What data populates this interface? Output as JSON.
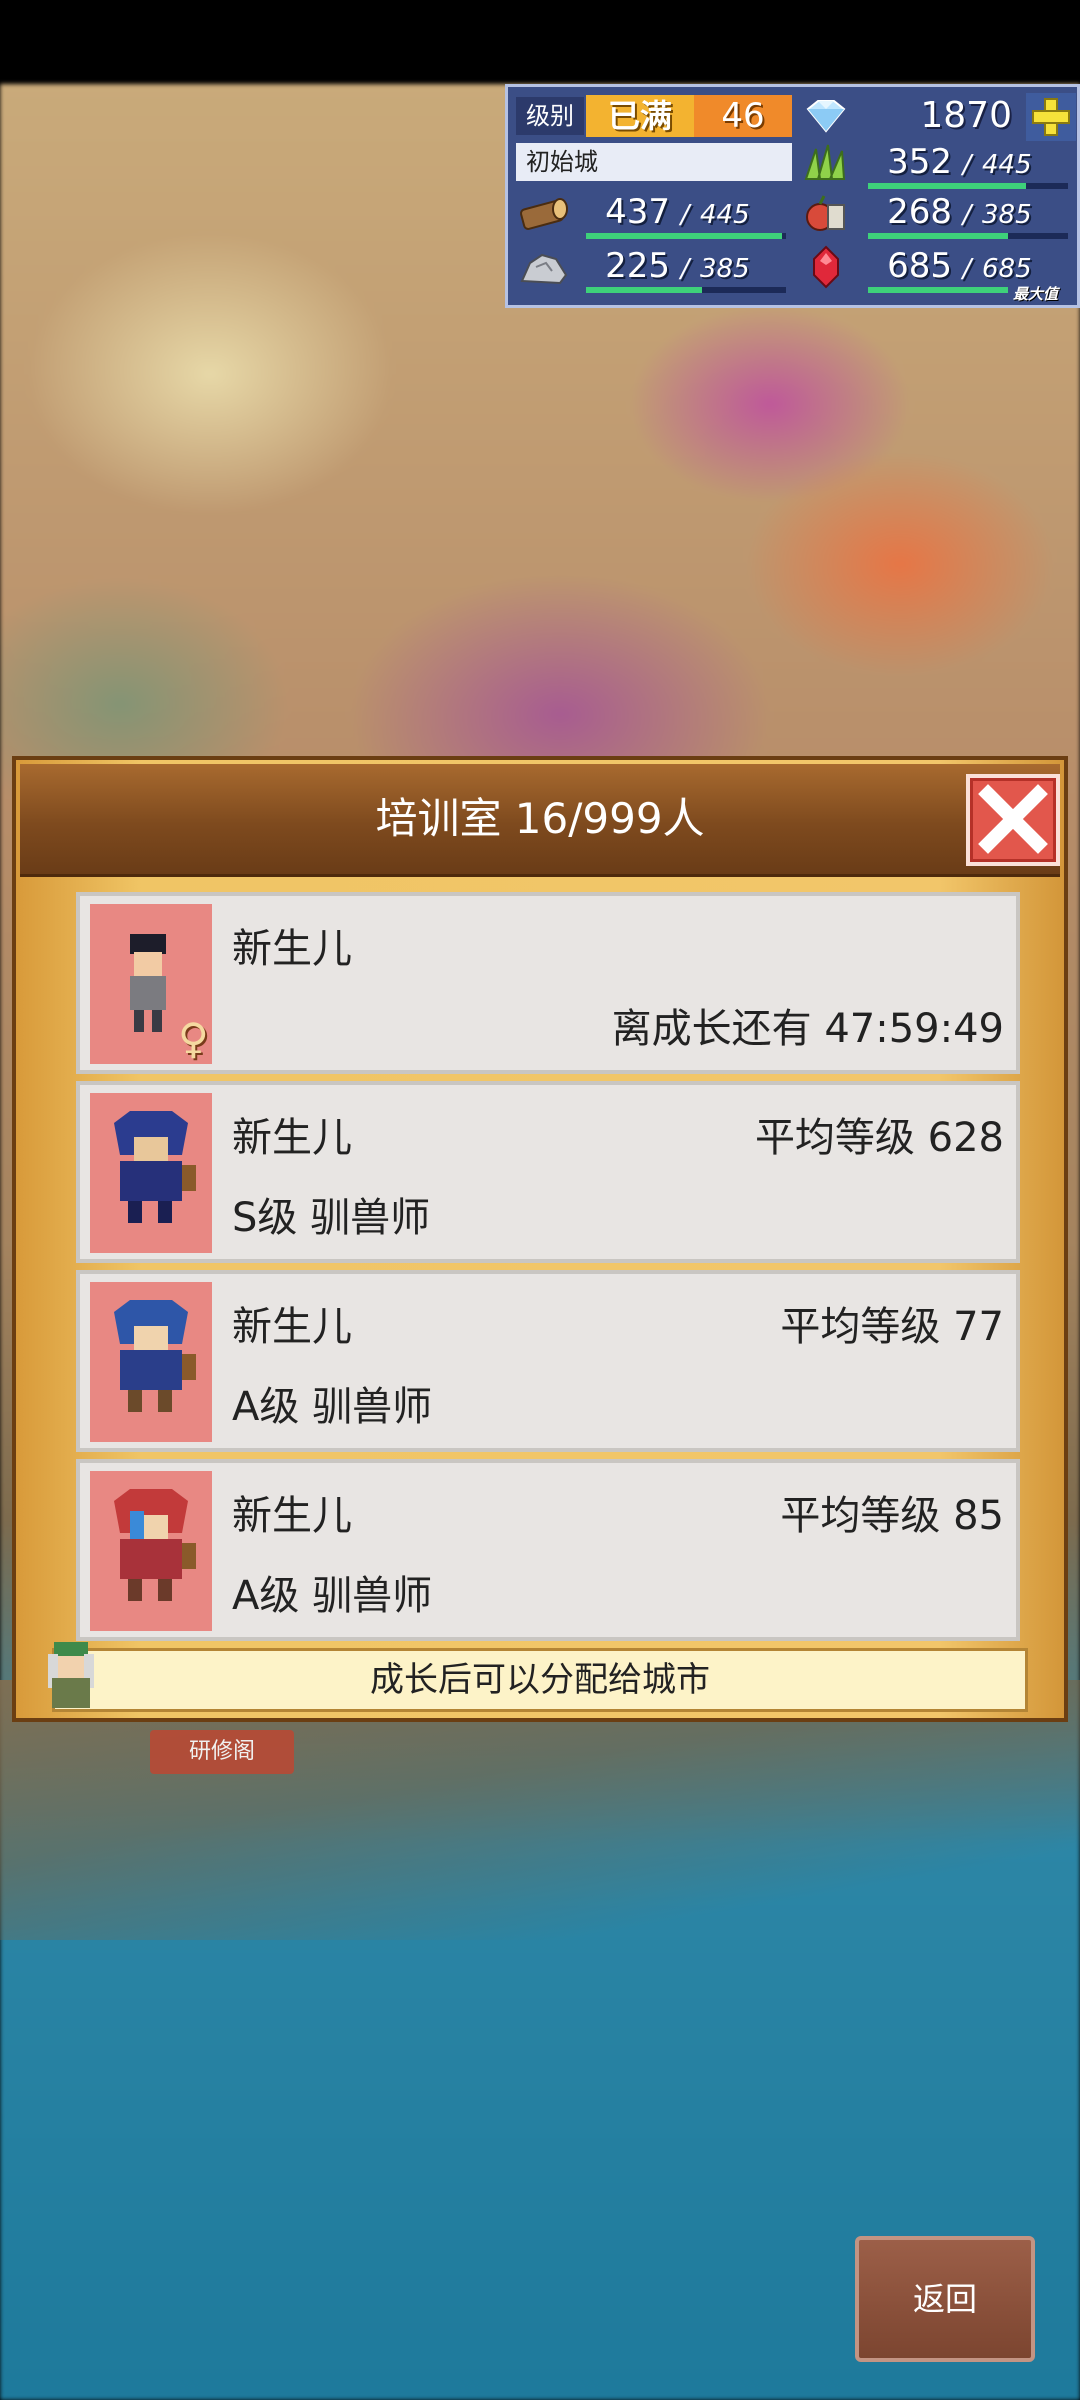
{
  "hud": {
    "level_label": "级别",
    "level_status": "已满",
    "level_value": "46",
    "gems": "1870",
    "town_name": "初始城",
    "resources": [
      {
        "icon": "grass-icon",
        "value": "352",
        "max": "445",
        "fill": 0.79
      },
      {
        "icon": "wood-log-icon",
        "value": "437",
        "max": "445",
        "fill": 0.98
      },
      {
        "icon": "apple-food-icon",
        "value": "268",
        "max": "385",
        "fill": 0.7
      },
      {
        "icon": "ore-rock-icon",
        "value": "225",
        "max": "385",
        "fill": 0.58
      },
      {
        "icon": "red-crystal-icon",
        "value": "685",
        "max": "685",
        "fill": 1.0,
        "tag": "最大值"
      }
    ]
  },
  "dialog": {
    "title": "培训室 16/999人",
    "rows": [
      {
        "name": "新生儿",
        "right_top": "",
        "sub": "",
        "right_bottom": "离成长还有   47:59:49",
        "portrait": "black-haired-child-avatar"
      },
      {
        "name": "新生儿",
        "right_top": "平均等级 628",
        "sub": "S级 驯兽师",
        "right_bottom": "",
        "portrait": "blue-hooded-tamer-avatar"
      },
      {
        "name": "新生儿",
        "right_top": "平均等级   77",
        "sub": "A级 驯兽师",
        "right_bottom": "",
        "portrait": "blue-hooded-tamer-avatar"
      },
      {
        "name": "新生儿",
        "right_top": "平均等级   85",
        "sub": "A级 驯兽师",
        "right_bottom": "",
        "portrait": "red-hooded-tamer-avatar"
      }
    ],
    "hint": "成长后可以分配给城市"
  },
  "building_tag": "研修阁",
  "back_label": "返回"
}
